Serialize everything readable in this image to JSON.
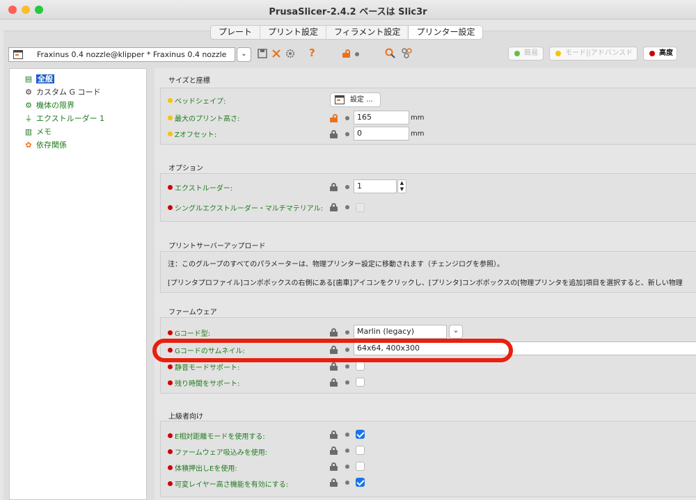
{
  "window": {
    "title": "PrusaSlicer-2.4.2 ベースは Slic3r"
  },
  "tabs": [
    {
      "label": "プレート"
    },
    {
      "label": "プリント設定"
    },
    {
      "label": "フィラメント設定"
    },
    {
      "label": "プリンター設定"
    }
  ],
  "preset": {
    "value": "Fraxinus 0.4 nozzle@klipper * Fraxinus 0.4 nozzle"
  },
  "toolbar": {
    "help": "?"
  },
  "modes": {
    "simple": "簡易",
    "advanced": "モード||アドバンスド",
    "expert": "高度"
  },
  "colors": {
    "accent": "#1b5fc9",
    "green_label": "#1e7b1e",
    "highlight": "#e8200f",
    "lock_open": "#e8731c",
    "bullet_yellow": "#f5c400",
    "bullet_red": "#d00000"
  },
  "tree": [
    {
      "label": "全般",
      "icon": "printer-icon"
    },
    {
      "label": "カスタム G コード",
      "icon": "gear-icon"
    },
    {
      "label": "機体の限界",
      "icon": "gear-icon"
    },
    {
      "label": "エクストルーダー 1",
      "icon": "extruder-icon"
    },
    {
      "label": "メモ",
      "icon": "note-icon"
    },
    {
      "label": "依存関係",
      "icon": "dependency-icon"
    }
  ],
  "size": {
    "title": "サイズと座標",
    "bed_shape_label": "ベッドシェイプ:",
    "bed_shape_button": "設定 ...",
    "max_height_label": "最大のプリント高さ:",
    "max_height_value": "165",
    "max_height_unit": "mm",
    "z_offset_label": "Zオフセット:",
    "z_offset_value": "0",
    "z_offset_unit": "mm"
  },
  "options": {
    "title": "オプション",
    "extruders_label": "エクストルーダー:",
    "extruders_value": "1",
    "single_multi_label": "シングルエクストルーダー・マルチマテリアル:"
  },
  "upload": {
    "title": "プリントサーバーアップロード",
    "note1": "注：このグループのすべてのパラメーターは、物理プリンター設定に移動されます（チェンジログを参照）。",
    "note2": "[プリンタプロファイル]コンボボックスの右側にある[歯車]アイコンをクリックし、[プリンタ]コンボボックスの[物理プリンタを追加]項目を選択すると、新しい物理"
  },
  "firmware": {
    "title": "ファームウェア",
    "gcode_flavor_label": "Gコード型:",
    "gcode_flavor_value": "Marlin (legacy)",
    "thumbnails_label": "Gコードのサムネイル:",
    "thumbnails_value": "64x64, 400x300",
    "silent_mode_label": "静音モードサポート:",
    "remaining_time_label": "残り時間をサポート:"
  },
  "advanced": {
    "title": "上級者向け",
    "relative_e_label": "E相対距離モードを使用する:",
    "relative_e_checked": true,
    "firmware_retract_label": "ファームウェア吸込みを使用:",
    "firmware_retract_checked": false,
    "volumetric_e_label": "体積押出しEを使用:",
    "volumetric_e_checked": false,
    "variable_layer_label": "可変レイヤー高さ機能を有効にする:",
    "variable_layer_checked": true
  }
}
